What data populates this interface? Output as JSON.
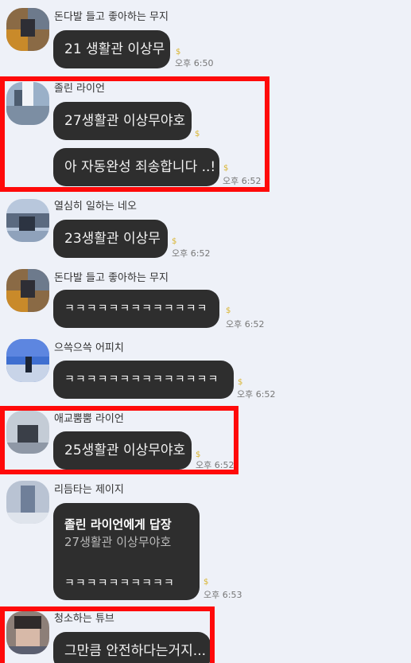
{
  "messages": [
    {
      "sender": "돈다발 들고 좋아하는 무지",
      "text": "21 생활관 이상무",
      "unread": "$",
      "time": "오후 6:50"
    },
    {
      "sender": "졸린 라이언",
      "text": "27생활관 이상무야호",
      "unread": "$"
    },
    {
      "text": "아 자동완성 죄송합니다 ..!",
      "unread": "$",
      "time": "오후 6:52"
    },
    {
      "sender": "열심히 일하는 네오",
      "text": "23생활관 이상무",
      "unread": "$",
      "time": "오후 6:52"
    },
    {
      "sender": "돈다발 들고 좋아하는 무지",
      "text": "ㅋㅋㅋㅋㅋㅋㅋㅋㅋㅋㅋㅋㅋ",
      "unread": "$",
      "time": "오후 6:52"
    },
    {
      "sender": "으쓱으쓱 어피치",
      "text": "ㅋㅋㅋㅋㅋㅋㅋㅋㅋㅋㅋㅋㅋㅋ",
      "unread": "$",
      "time": "오후 6:52"
    },
    {
      "sender": "애교뿜뿜 라이언",
      "text": "25생활관 이상무야호",
      "unread": "$",
      "time": "오후 6:52"
    },
    {
      "sender": "리듬타는 제이지",
      "reply_title": "졸린 라이언에게 답장",
      "reply_quote": "27생활관 이상무야호",
      "text": "ㅋㅋㅋㅋㅋㅋㅋㅋㅋㅋ",
      "unread": "$",
      "time": "오후 6:53"
    },
    {
      "sender": "청소하는 튜브",
      "text": "그만큼 안전하다는거지..."
    }
  ],
  "colors": {
    "background": "#eef1f8",
    "bubble": "#2e2e2e",
    "highlight": "#ff0a0a",
    "unread": "#d9b531"
  }
}
